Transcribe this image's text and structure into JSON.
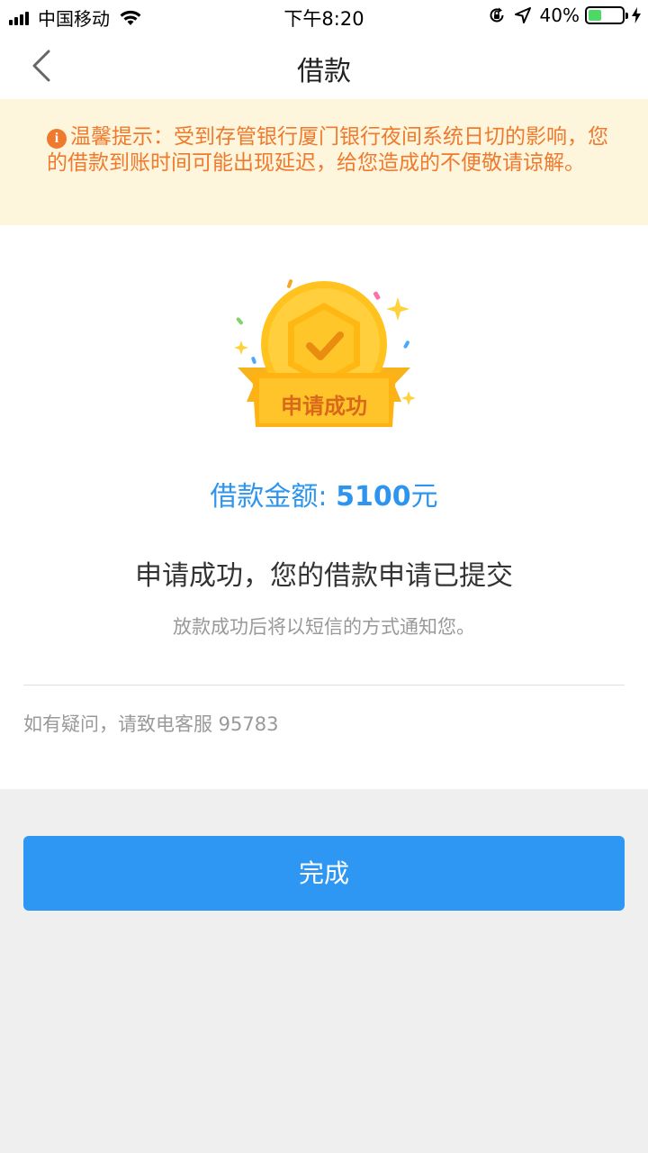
{
  "status_bar": {
    "carrier": "中国移动",
    "time": "下午8:20",
    "battery_percent": "40%",
    "battery_level": 0.4,
    "icons": [
      "signal-icon",
      "wifi-icon",
      "orientation-lock-icon",
      "location-icon",
      "battery-icon",
      "charging-icon"
    ]
  },
  "nav": {
    "title": "借款",
    "back_icon": "chevron-left-icon"
  },
  "notice": {
    "icon": "info-icon",
    "icon_glyph": "i",
    "text": "温馨提示：受到存管银行厦门银行夜间系统日切的影响，您的借款到账时间可能出现延迟，给您造成的不便敬请谅解。"
  },
  "badge": {
    "label": "申请成功",
    "icon": "success-medal-icon"
  },
  "amount": {
    "label": "借款金额: ",
    "value": "5100",
    "unit": "元"
  },
  "result": {
    "title": "申请成功，您的借款申请已提交",
    "subtitle": "放款成功后将以短信的方式通知您。"
  },
  "contact": {
    "text": "如有疑问，请致电客服 95783"
  },
  "done_button": {
    "label": "完成"
  },
  "colors": {
    "accent": "#2d97f3",
    "amount": "#2e95ee",
    "notice_text": "#ef7a2e",
    "notice_bg": "#fdf6dd",
    "battery_green": "#4cd964"
  }
}
